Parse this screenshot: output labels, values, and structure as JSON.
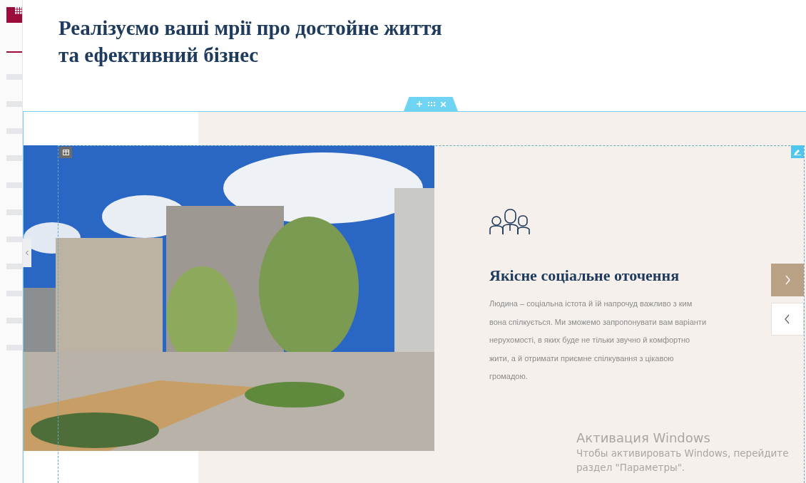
{
  "heading": {
    "lines": [
      "Реалізуємо ваші мрії про достойне життя",
      "та ефективний бізнес"
    ]
  },
  "slide": {
    "title": "Якісне соціальне оточення",
    "body": "Людина – соціальна істота й їй напрочуд важливо з ким вона спілкується. Ми зможемо запропонувати вам варіанти нерухомості, в яких буде не тільки звучно й комфортно жити, а й отримати приємне спілкування з цікавою громадою."
  },
  "slider_controls": [
    {
      "kind": "next",
      "highlighted": true
    },
    {
      "kind": "prev",
      "highlighted": false
    }
  ],
  "os_notice": {
    "title": "Активация Windows",
    "lines": [
      "Чтобы активировать Windows, перейдите",
      "раздел \"Параметры\"."
    ]
  }
}
